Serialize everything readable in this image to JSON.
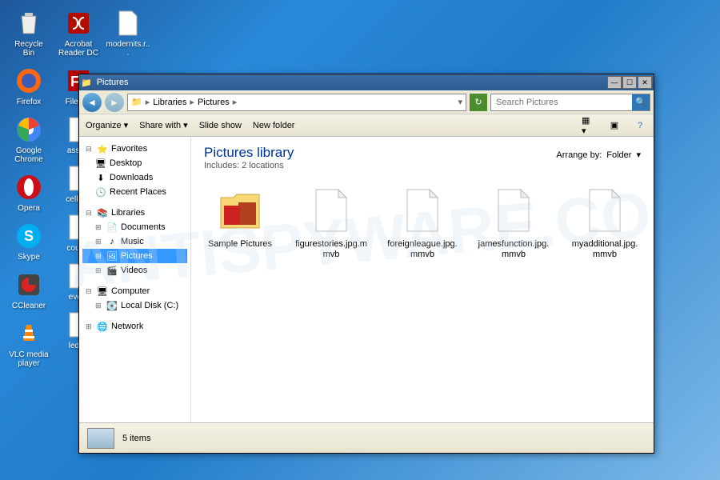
{
  "desktop": {
    "col1": [
      {
        "name": "Recycle Bin",
        "icon": "recycle"
      },
      {
        "name": "Firefox",
        "icon": "firefox"
      },
      {
        "name": "Google Chrome",
        "icon": "chrome"
      },
      {
        "name": "Opera",
        "icon": "opera"
      },
      {
        "name": "Skype",
        "icon": "skype"
      },
      {
        "name": "CCleaner",
        "icon": "ccleaner"
      },
      {
        "name": "VLC media player",
        "icon": "vlc"
      }
    ],
    "col2": [
      {
        "name": "Acrobat Reader DC",
        "icon": "acrobat"
      },
      {
        "name": "FileZi...",
        "icon": "filezilla"
      },
      {
        "name": "associ",
        "icon": "file"
      },
      {
        "name": "cellcon",
        "icon": "file"
      },
      {
        "name": "counci",
        "icon": "file"
      },
      {
        "name": "every",
        "icon": "file"
      },
      {
        "name": "leded",
        "icon": "file"
      }
    ],
    "col3": [
      {
        "name": "modernits.r...",
        "icon": "file"
      }
    ]
  },
  "window": {
    "title": "Pictures",
    "breadcrumb": [
      "Libraries",
      "Pictures"
    ],
    "search_placeholder": "Search Pictures",
    "toolbar": {
      "organize": "Organize",
      "share": "Share with",
      "slideshow": "Slide show",
      "newfolder": "New folder"
    },
    "sidebar": {
      "favorites": {
        "label": "Favorites",
        "items": [
          "Desktop",
          "Downloads",
          "Recent Places"
        ]
      },
      "libraries": {
        "label": "Libraries",
        "items": [
          "Documents",
          "Music",
          "Pictures",
          "Videos"
        ],
        "selected": "Pictures"
      },
      "computer": {
        "label": "Computer",
        "items": [
          "Local Disk (C:)"
        ]
      },
      "network": {
        "label": "Network"
      }
    },
    "content": {
      "heading": "Pictures library",
      "subheading": "Includes:  2 locations",
      "arrange_label": "Arrange by:",
      "arrange_value": "Folder",
      "items": [
        {
          "name": "Sample Pictures",
          "type": "folder"
        },
        {
          "name": "figurestories.jpg.mmvb",
          "type": "file"
        },
        {
          "name": "foreignleague.jpg.mmvb",
          "type": "file"
        },
        {
          "name": "jamesfunction.jpg.mmvb",
          "type": "file"
        },
        {
          "name": "myadditional.jpg.mmvb",
          "type": "file"
        }
      ]
    },
    "status": {
      "count": "5 items"
    }
  },
  "watermark": "ANTISPYWARE.CO"
}
